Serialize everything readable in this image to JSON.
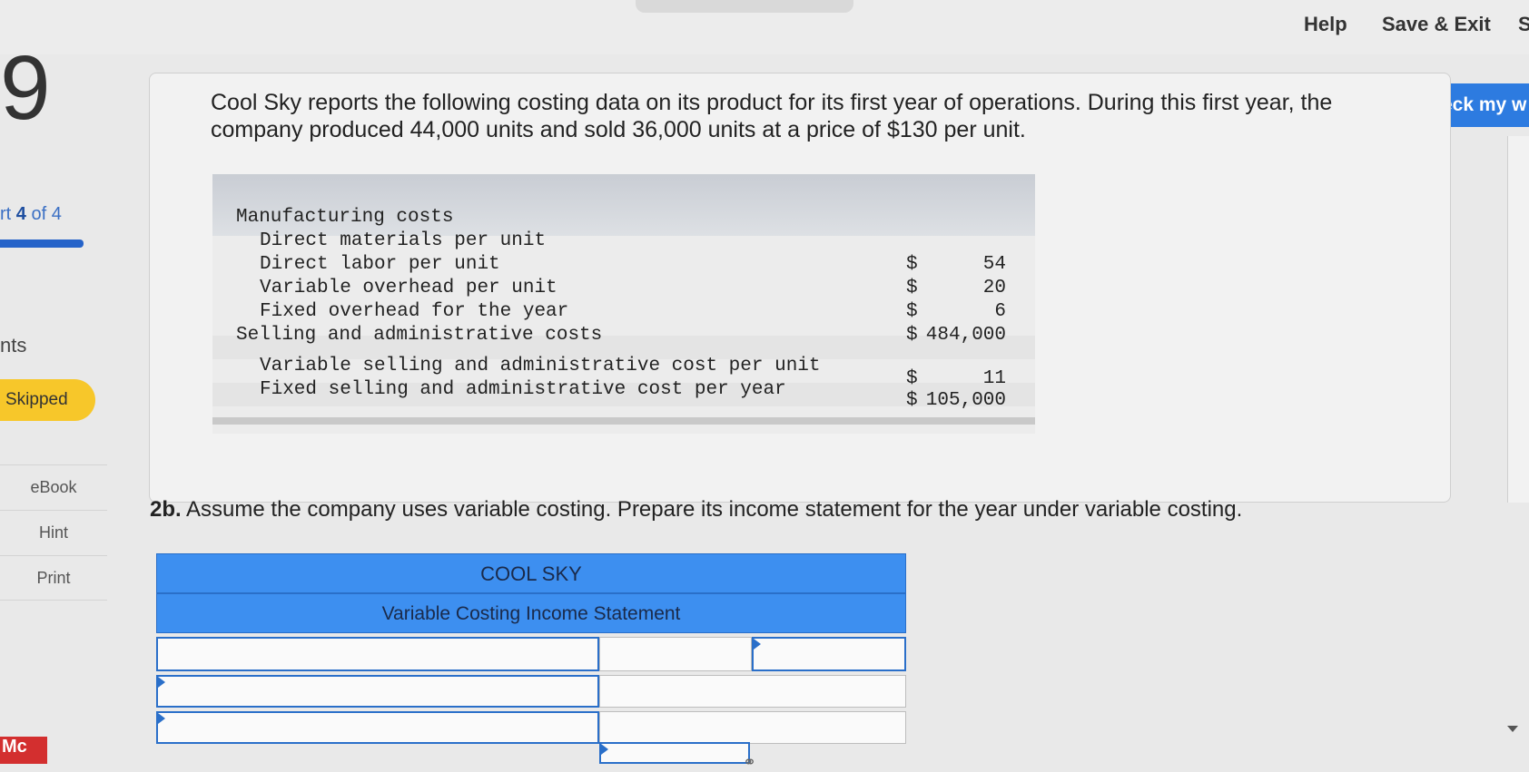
{
  "header": {
    "help_label": "Help",
    "save_exit_label": "Save & Exit",
    "submit_partial": "S"
  },
  "rail": {
    "question_number": "9",
    "part_prefix": "rt",
    "part_current": "4",
    "part_suffix": "of 4",
    "points_label": "nts",
    "status_badge": "Skipped",
    "ebook_label": "eBook",
    "hint_label": "Hint",
    "print_label": "Print",
    "logo_text": "Mc"
  },
  "check_button_label": "Check my w",
  "problem": {
    "text": "Cool Sky reports the following costing data on its product for its first year of operations. During this first year, the company produced 44,000 units and sold 36,000 units at a price of $130 per unit.",
    "rows": [
      {
        "label": "Manufacturing costs",
        "symbol": "",
        "value": ""
      },
      {
        "label": "Direct materials per unit",
        "symbol": "",
        "value": ""
      },
      {
        "label": "Direct labor per unit",
        "symbol": "$",
        "value": "54"
      },
      {
        "label": "Variable overhead per unit",
        "symbol": "$",
        "value": "20"
      },
      {
        "label": "Fixed overhead for the year",
        "symbol": "$",
        "value": "6"
      },
      {
        "label": "Selling and administrative costs",
        "symbol": "$",
        "value": "484,000"
      },
      {
        "label": "Variable selling and administrative cost per unit",
        "symbol": "$",
        "value": "11"
      },
      {
        "label": "Fixed selling and administrative cost per year",
        "symbol": "$",
        "value": "105,000"
      }
    ]
  },
  "requirement": {
    "label": "2b.",
    "text": "Assume the company uses variable costing. Prepare its income statement for the year under variable costing."
  },
  "income_statement": {
    "company": "COOL SKY",
    "title": "Variable Costing Income Statement"
  }
}
